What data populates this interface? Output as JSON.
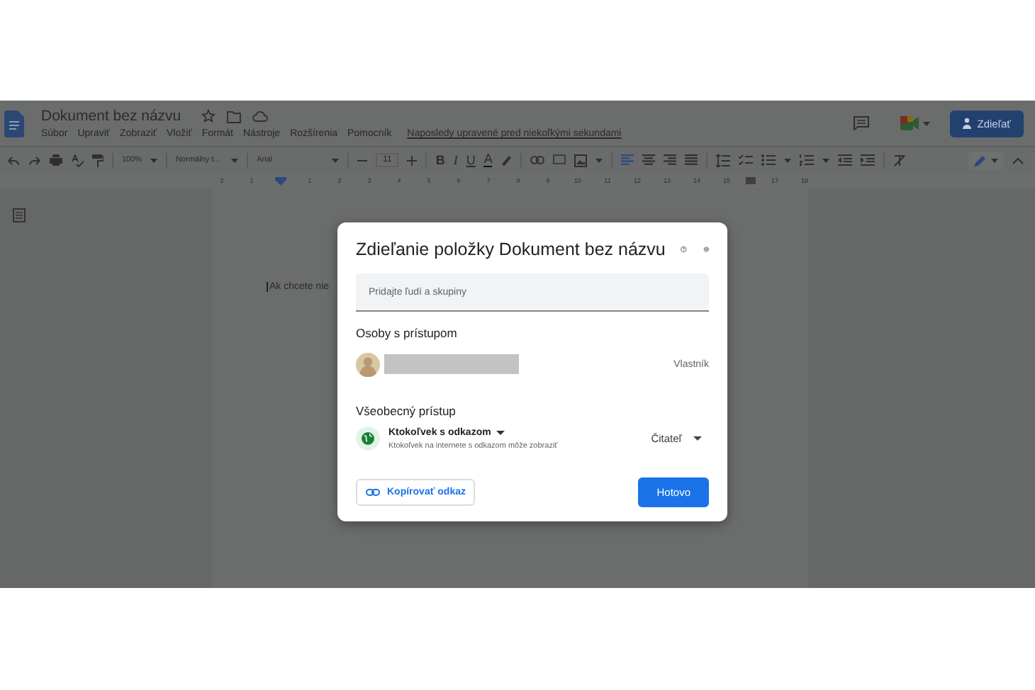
{
  "document": {
    "title": "Dokument bez názvu",
    "menu": [
      "Súbor",
      "Upraviť",
      "Zobraziť",
      "Vložiť",
      "Formát",
      "Nástroje",
      "Rozšírenia",
      "Pomocník"
    ],
    "last_edit": "Naposledy upravené pred niekoľkými sekundami",
    "share_button": "Zdieľať",
    "body_text": "Ak chcete nie"
  },
  "toolbar": {
    "zoom": "100%",
    "style": "Normálny t...",
    "font": "Arial",
    "font_size": "11",
    "format_buttons": [
      "B",
      "I",
      "U",
      "A"
    ],
    "alignment": [
      {
        "selected": true
      },
      {
        "selected": false
      },
      {
        "selected": false
      },
      {
        "selected": false
      }
    ]
  },
  "ruler": [
    "2",
    "1",
    "1",
    "2",
    "3",
    "4",
    "5",
    "6",
    "7",
    "8",
    "9",
    "10",
    "11",
    "12",
    "13",
    "14",
    "15",
    "17",
    "18"
  ],
  "share_dialog": {
    "title": "Zdieľanie položky Dokument bez názvu",
    "add_people_placeholder": "Pridajte ľudí a skupiny",
    "people_heading": "Osoby s prístupom",
    "people": [
      {
        "role": "Vlastník"
      }
    ],
    "general_access_heading": "Všeobecný prístup",
    "access_option": "Ktokoľvek s odkazom",
    "access_description": "Ktokoľvek na internete s odkazom môže zobraziť",
    "access_role": "Čitateľ",
    "copy_link_button": "Kopírovať odkaz",
    "done_button": "Hotovo"
  }
}
